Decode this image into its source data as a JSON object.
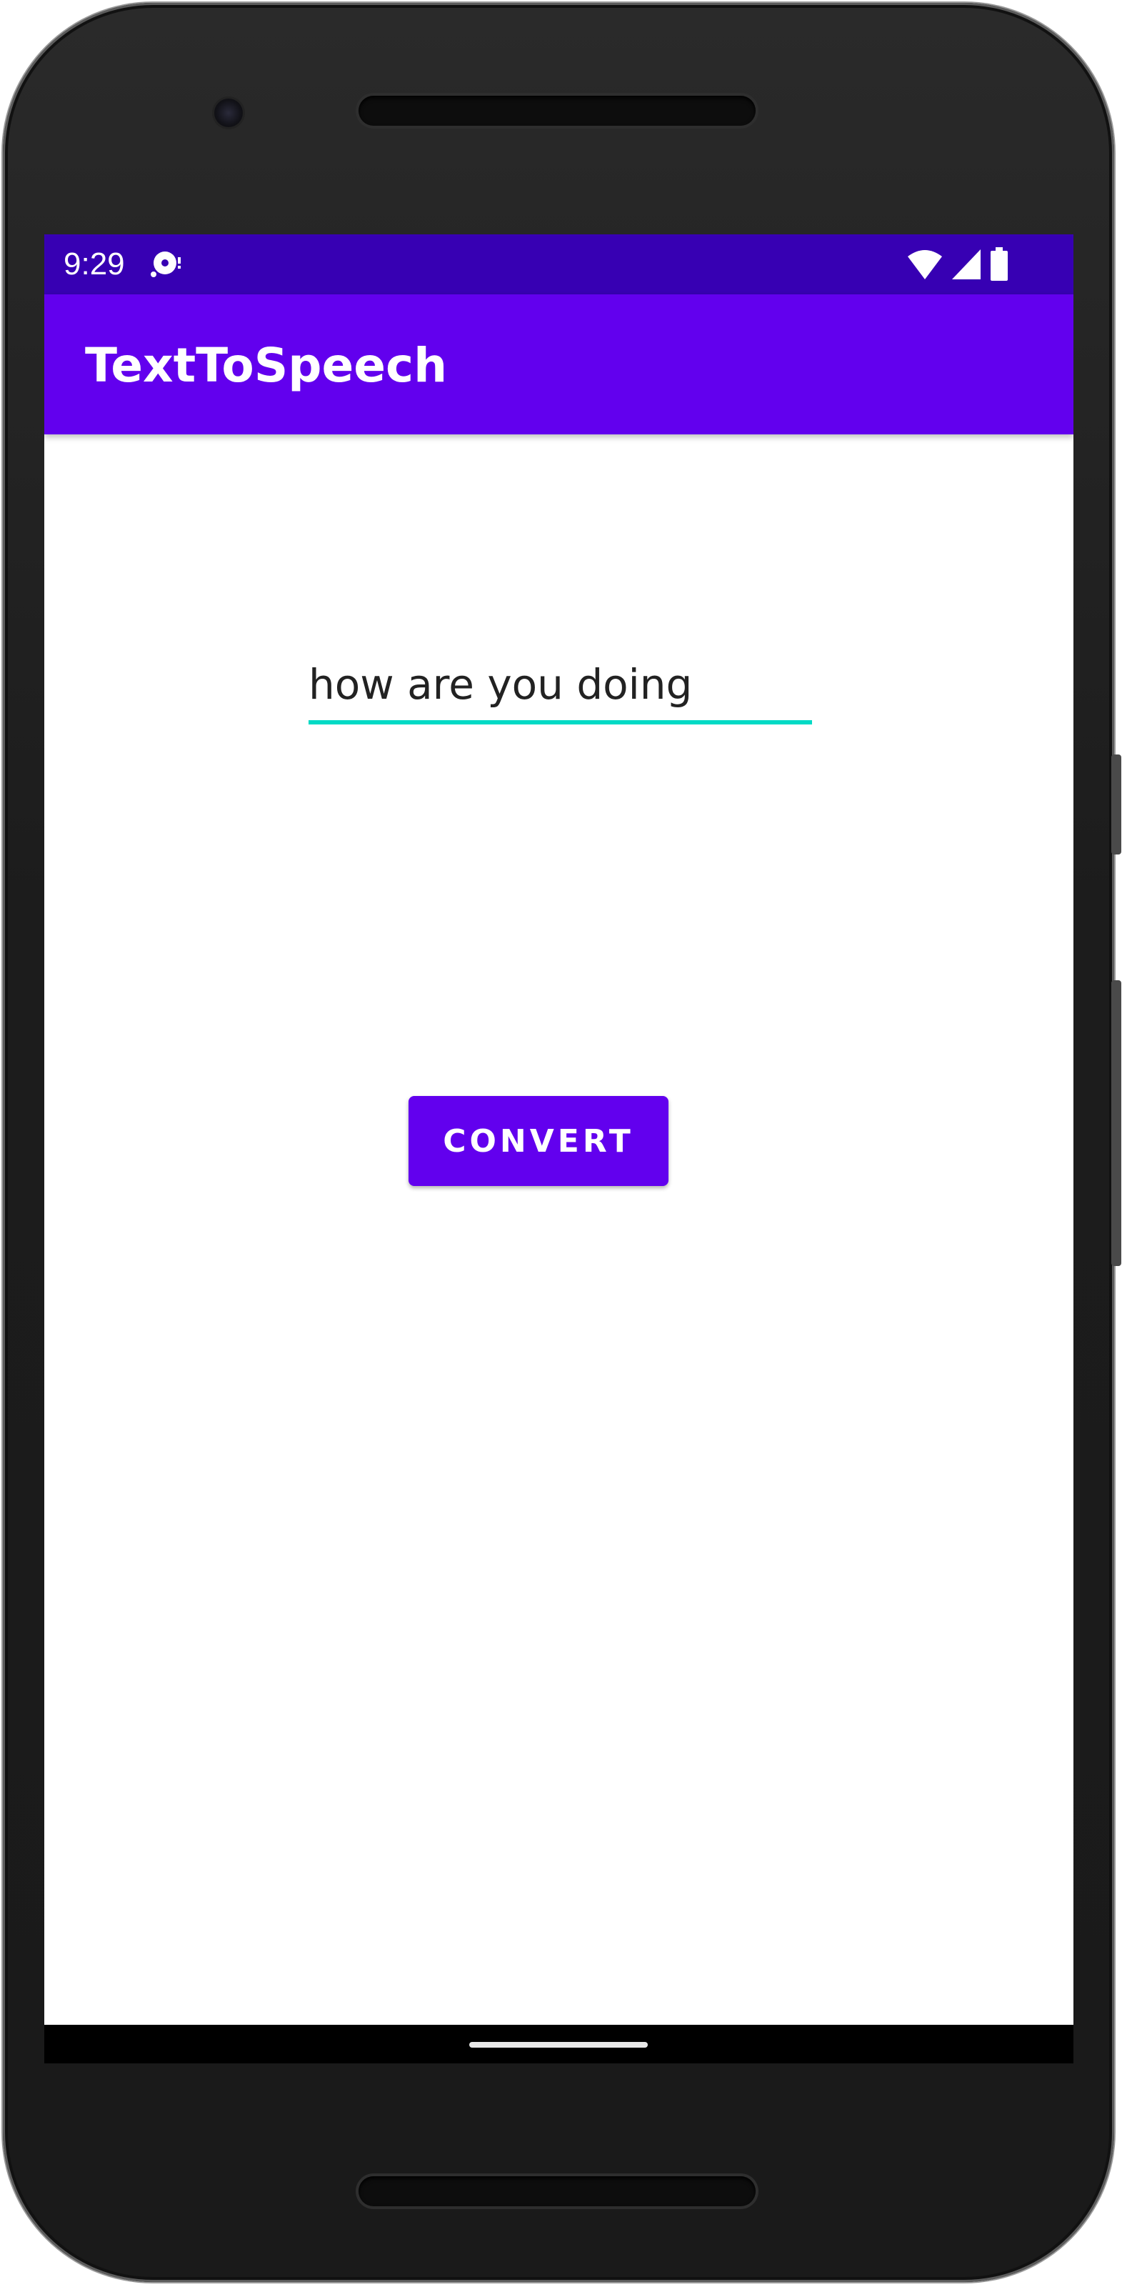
{
  "status_bar": {
    "time": "9:29",
    "notification_icon": "media-notification-icon",
    "wifi_icon": "wifi-icon",
    "signal_icon": "cell-signal-icon",
    "battery_icon": "battery-icon",
    "background_color": "#3700b3"
  },
  "app_bar": {
    "title": "TextToSpeech",
    "background_color": "#6200ee"
  },
  "main": {
    "text_input": {
      "value": "how are you doing",
      "underline_color": "#03dac5"
    },
    "convert_button": {
      "label": "CONVERT",
      "background_color": "#6200ee"
    }
  },
  "nav_bar": {
    "home_indicator": "home-gesture-pill"
  }
}
